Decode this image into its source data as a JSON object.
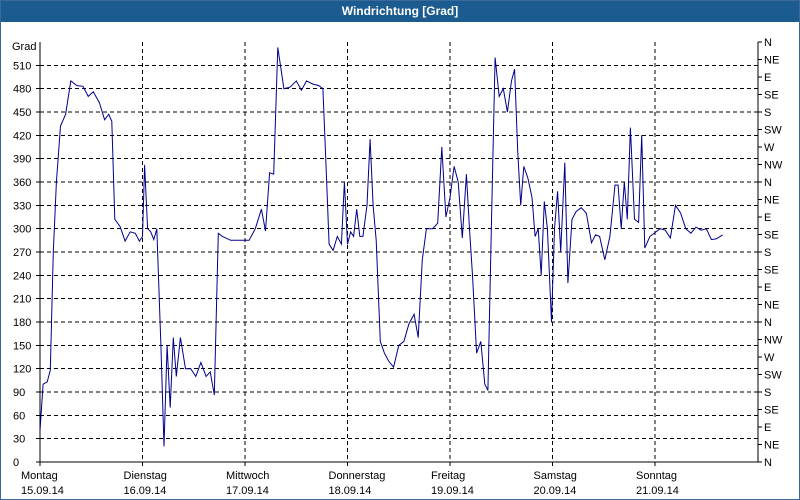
{
  "window": {
    "title": "Windrichtung [Grad]"
  },
  "colors": {
    "titlebar": "#1c5b8f",
    "series": "#00008b",
    "grid": "#000000"
  },
  "chart_data": {
    "type": "line",
    "title": "Windrichtung [Grad]",
    "ylabel": "Grad",
    "ylim": [
      0,
      540
    ],
    "y_ticks": [
      0,
      30,
      60,
      90,
      120,
      150,
      180,
      210,
      240,
      270,
      300,
      330,
      360,
      390,
      420,
      450,
      480,
      510
    ],
    "right_axis_labels": [
      "N",
      "NE",
      "E",
      "SE",
      "S",
      "SW",
      "W",
      "NW",
      "N",
      "NE",
      "E",
      "SE",
      "S",
      "SE",
      "E",
      "NE",
      "N",
      "NW",
      "W",
      "SW",
      "S",
      "SE",
      "E",
      "NE",
      "N"
    ],
    "x_categories": [
      {
        "day": "Montag",
        "date": "15.09.14"
      },
      {
        "day": "Dienstag",
        "date": "16.09.14"
      },
      {
        "day": "Mittwoch",
        "date": "17.09.14"
      },
      {
        "day": "Donnerstag",
        "date": "18.09.14"
      },
      {
        "day": "Freitag",
        "date": "19.09.14"
      },
      {
        "day": "Samstag",
        "date": "20.09.14"
      },
      {
        "day": "Sonntag",
        "date": "21.09.14"
      }
    ],
    "x_range_days": [
      0,
      7
    ],
    "grid": true,
    "series": [
      {
        "values": [
          [
            0.0,
            40
          ],
          [
            0.03,
            100
          ],
          [
            0.07,
            103
          ],
          [
            0.1,
            118
          ],
          [
            0.13,
            270
          ],
          [
            0.16,
            360
          ],
          [
            0.2,
            432
          ],
          [
            0.25,
            447
          ],
          [
            0.3,
            490
          ],
          [
            0.36,
            484
          ],
          [
            0.42,
            483
          ],
          [
            0.47,
            470
          ],
          [
            0.52,
            476
          ],
          [
            0.58,
            462
          ],
          [
            0.63,
            440
          ],
          [
            0.67,
            447
          ],
          [
            0.7,
            438
          ],
          [
            0.73,
            312
          ],
          [
            0.78,
            303
          ],
          [
            0.83,
            284
          ],
          [
            0.88,
            296
          ],
          [
            0.93,
            294
          ],
          [
            0.97,
            284
          ],
          [
            1.0,
            290
          ],
          [
            1.02,
            382
          ],
          [
            1.05,
            300
          ],
          [
            1.08,
            296
          ],
          [
            1.11,
            286
          ],
          [
            1.14,
            300
          ],
          [
            1.18,
            150
          ],
          [
            1.21,
            20
          ],
          [
            1.24,
            150
          ],
          [
            1.27,
            70
          ],
          [
            1.3,
            160
          ],
          [
            1.33,
            110
          ],
          [
            1.37,
            160
          ],
          [
            1.42,
            120
          ],
          [
            1.47,
            120
          ],
          [
            1.52,
            110
          ],
          [
            1.57,
            128
          ],
          [
            1.62,
            110
          ],
          [
            1.66,
            116
          ],
          [
            1.7,
            86
          ],
          [
            1.74,
            294
          ],
          [
            1.78,
            290
          ],
          [
            1.86,
            285
          ],
          [
            1.95,
            285
          ],
          [
            2.04,
            285
          ],
          [
            2.1,
            300
          ],
          [
            2.16,
            325
          ],
          [
            2.2,
            297
          ],
          [
            2.24,
            372
          ],
          [
            2.28,
            370
          ],
          [
            2.32,
            533
          ],
          [
            2.38,
            480
          ],
          [
            2.44,
            482
          ],
          [
            2.5,
            490
          ],
          [
            2.55,
            478
          ],
          [
            2.6,
            490
          ],
          [
            2.66,
            486
          ],
          [
            2.72,
            484
          ],
          [
            2.76,
            480
          ],
          [
            2.79,
            382
          ],
          [
            2.82,
            280
          ],
          [
            2.86,
            272
          ],
          [
            2.9,
            290
          ],
          [
            2.94,
            280
          ],
          [
            2.97,
            360
          ],
          [
            3.0,
            280
          ],
          [
            3.03,
            296
          ],
          [
            3.06,
            290
          ],
          [
            3.09,
            325
          ],
          [
            3.12,
            290
          ],
          [
            3.15,
            290
          ],
          [
            3.19,
            330
          ],
          [
            3.22,
            415
          ],
          [
            3.25,
            330
          ],
          [
            3.28,
            285
          ],
          [
            3.32,
            155
          ],
          [
            3.36,
            140
          ],
          [
            3.4,
            130
          ],
          [
            3.45,
            122
          ],
          [
            3.5,
            150
          ],
          [
            3.55,
            155
          ],
          [
            3.6,
            178
          ],
          [
            3.65,
            190
          ],
          [
            3.69,
            160
          ],
          [
            3.73,
            260
          ],
          [
            3.77,
            300
          ],
          [
            3.83,
            300
          ],
          [
            3.88,
            307
          ],
          [
            3.92,
            405
          ],
          [
            3.96,
            315
          ],
          [
            4.0,
            340
          ],
          [
            4.04,
            380
          ],
          [
            4.08,
            360
          ],
          [
            4.12,
            288
          ],
          [
            4.16,
            370
          ],
          [
            4.19,
            300
          ],
          [
            4.22,
            240
          ],
          [
            4.26,
            140
          ],
          [
            4.3,
            155
          ],
          [
            4.34,
            100
          ],
          [
            4.37,
            92
          ],
          [
            4.41,
            340
          ],
          [
            4.44,
            520
          ],
          [
            4.48,
            470
          ],
          [
            4.52,
            480
          ],
          [
            4.56,
            450
          ],
          [
            4.6,
            490
          ],
          [
            4.63,
            505
          ],
          [
            4.66,
            400
          ],
          [
            4.69,
            330
          ],
          [
            4.72,
            380
          ],
          [
            4.76,
            365
          ],
          [
            4.8,
            340
          ],
          [
            4.83,
            290
          ],
          [
            4.86,
            300
          ],
          [
            4.89,
            240
          ],
          [
            4.92,
            335
          ],
          [
            4.95,
            300
          ],
          [
            4.99,
            180
          ],
          [
            5.02,
            300
          ],
          [
            5.05,
            348
          ],
          [
            5.08,
            270
          ],
          [
            5.12,
            385
          ],
          [
            5.15,
            230
          ],
          [
            5.19,
            312
          ],
          [
            5.23,
            322
          ],
          [
            5.28,
            327
          ],
          [
            5.33,
            320
          ],
          [
            5.38,
            282
          ],
          [
            5.42,
            292
          ],
          [
            5.46,
            290
          ],
          [
            5.51,
            260
          ],
          [
            5.56,
            290
          ],
          [
            5.61,
            356
          ],
          [
            5.64,
            356
          ],
          [
            5.67,
            300
          ],
          [
            5.7,
            360
          ],
          [
            5.73,
            312
          ],
          [
            5.76,
            430
          ],
          [
            5.8,
            312
          ],
          [
            5.84,
            308
          ],
          [
            5.87,
            420
          ],
          [
            5.9,
            275
          ],
          [
            5.95,
            290
          ],
          [
            6.0,
            295
          ],
          [
            6.05,
            300
          ],
          [
            6.1,
            298
          ],
          [
            6.15,
            288
          ],
          [
            6.2,
            330
          ],
          [
            6.25,
            320
          ],
          [
            6.3,
            300
          ],
          [
            6.35,
            294
          ],
          [
            6.4,
            302
          ],
          [
            6.45,
            298
          ],
          [
            6.5,
            300
          ],
          [
            6.55,
            286
          ],
          [
            6.6,
            287
          ],
          [
            6.66,
            292
          ]
        ]
      }
    ]
  }
}
